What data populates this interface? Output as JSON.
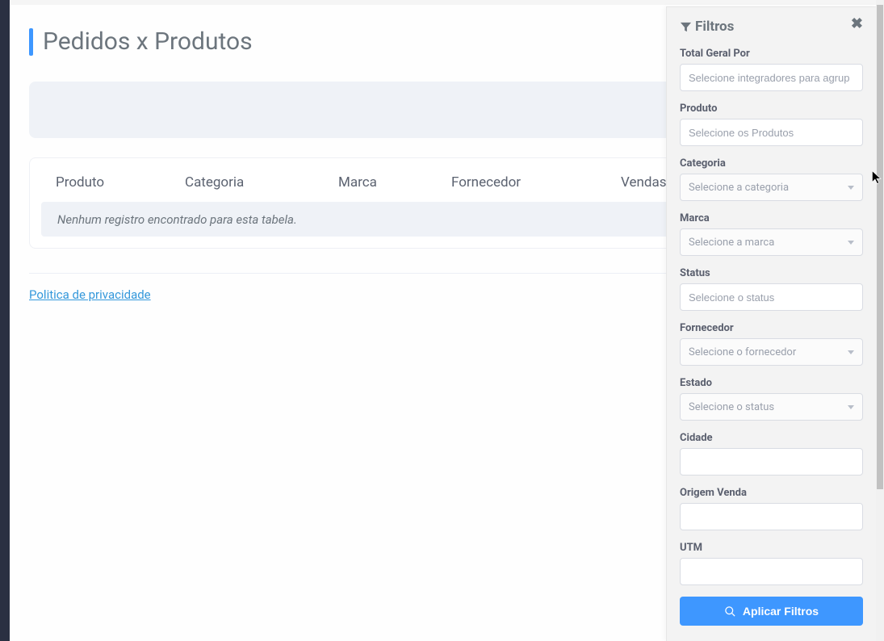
{
  "page": {
    "title": "Pedidos x Produtos"
  },
  "table": {
    "columns": [
      "Produto",
      "Categoria",
      "Marca",
      "Fornecedor",
      "Vendas"
    ],
    "empty_message": "Nenhum registro encontrado para esta tabela."
  },
  "footer": {
    "privacy_link": "Politica de privacidade"
  },
  "filters_panel": {
    "title": "Filtros",
    "fields": {
      "total_geral_por": {
        "label": "Total Geral Por",
        "placeholder": "Selecione integradores para agrup"
      },
      "produto": {
        "label": "Produto",
        "placeholder": "Selecione os Produtos"
      },
      "categoria": {
        "label": "Categoria",
        "placeholder": "Selecione a categoria"
      },
      "marca": {
        "label": "Marca",
        "placeholder": "Selecione a marca"
      },
      "status": {
        "label": "Status",
        "placeholder": "Selecione o status"
      },
      "fornecedor": {
        "label": "Fornecedor",
        "placeholder": "Selecione o fornecedor"
      },
      "estado": {
        "label": "Estado",
        "placeholder": "Selecione o status"
      },
      "cidade": {
        "label": "Cidade",
        "placeholder": ""
      },
      "origem_venda": {
        "label": "Origem Venda",
        "placeholder": ""
      },
      "utm": {
        "label": "UTM",
        "placeholder": ""
      }
    },
    "apply_label": "Aplicar Filtros"
  }
}
